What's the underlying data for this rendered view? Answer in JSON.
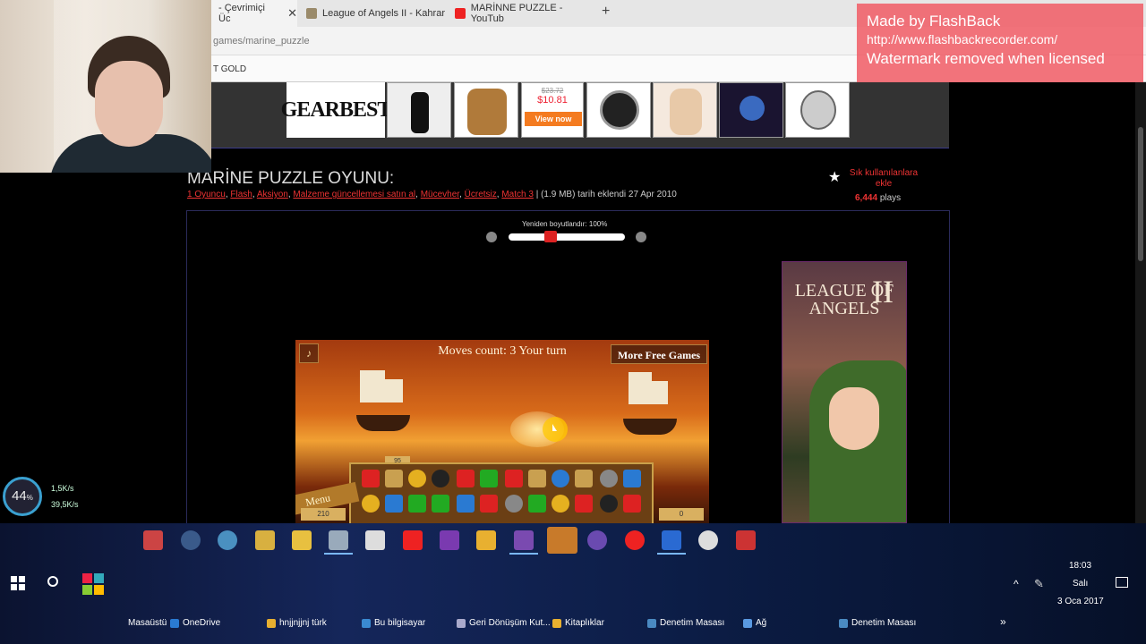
{
  "browser": {
    "tabs": [
      {
        "label": "- Çevrimiçi Üc",
        "icon": "page-icon"
      },
      {
        "label": "League of Angels II - Kahrar",
        "icon": "game-icon"
      },
      {
        "label": "MARİNNE PUZZLE - YouTub",
        "icon": "youtube-icon"
      }
    ],
    "address": "games/marine_puzzle",
    "favorites_text": "T GOLD",
    "new_tab": "+"
  },
  "watermark": {
    "line1": "Made by FlashBack",
    "line2": "http://www.flashbackrecorder.com/",
    "line3": "Watermark removed when licensed"
  },
  "ad": {
    "brand": "GEARBEST",
    "price_old": "$23.72",
    "price_new": "$10.81",
    "cta": "View now"
  },
  "page": {
    "title": "MARİNE PUZZLE OYUNU:",
    "tags": [
      "1 Oyuncu",
      "Flash",
      "Aksiyon",
      "Malzeme güncellemesi satın al",
      "Mücevher",
      "Ücretsiz",
      "Match 3"
    ],
    "size_info": "| (1.9 MB) tarih eklendi 27 Apr 2010",
    "favorite_label": "Sık kullanılanlara ekle",
    "plays_count": "6,444",
    "plays_label": "plays",
    "resize_label": "Yeniden boyutlandır: 100%"
  },
  "game": {
    "moves_text": "Moves count: 3 Your turn",
    "more_games": "More Free Games",
    "menu": "Menu",
    "score_left": "210",
    "score_right": "0",
    "level": "95"
  },
  "side_ad": {
    "title": "LEAGUE OF ANGELS",
    "numeral": "II"
  },
  "net_meter": {
    "percent": "44",
    "up": "1,5K/s",
    "down": "39,5K/s"
  },
  "taskbar": {
    "time": "18:03",
    "day": "Salı",
    "date": "3 Oca 2017",
    "toolbar_items": [
      "Masaüstü",
      "OneDrive",
      "hnjjnjjnj türk",
      "Bu bilgisayar",
      "Geri Dönüşüm Kut...",
      "Kitaplıklar",
      "Denetim Masası",
      "Ağ",
      "Denetim Masası"
    ],
    "more": "»"
  }
}
